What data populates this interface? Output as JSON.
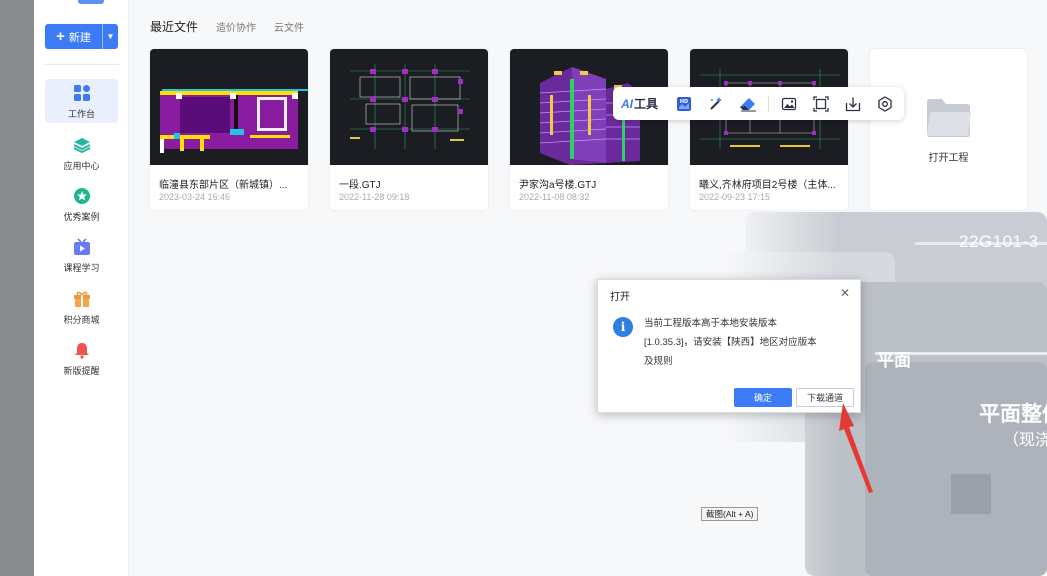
{
  "sidebar": {
    "new_button": {
      "label": "新建"
    },
    "items": [
      {
        "label": "工作台",
        "icon": "grid-icon",
        "active": true
      },
      {
        "label": "应用中心",
        "icon": "layers-icon"
      },
      {
        "label": "优秀案例",
        "icon": "star-badge-icon"
      },
      {
        "label": "课程学习",
        "icon": "tv-play-icon"
      },
      {
        "label": "积分商城",
        "icon": "gift-icon"
      },
      {
        "label": "新版提醒",
        "icon": "bell-icon"
      }
    ]
  },
  "tabs": [
    {
      "label": "最近文件",
      "active": true
    },
    {
      "label": "造价协作"
    },
    {
      "label": "云文件"
    }
  ],
  "files": [
    {
      "name": "临潼县东部片区（新城镇）...",
      "date": "2023-03-24 16:46"
    },
    {
      "name": "一段.GTJ",
      "date": "2022-11-28 09:18"
    },
    {
      "name": "尹家沟a号楼.GTJ",
      "date": "2022-11-08 08:32"
    },
    {
      "name": "曦义,齐林府项目2号楼（主体...",
      "date": "2022-09-23 17:15"
    }
  ],
  "open_project": {
    "label": "打开工程"
  },
  "ai_toolbar": {
    "ai_prefix": "AI",
    "label": "工具",
    "icons": [
      "hd-icon",
      "magic-wand-icon",
      "eraser-icon",
      "image-icon",
      "crop-icon",
      "download-icon",
      "settings-icon"
    ]
  },
  "dialog": {
    "title": "打开",
    "message_lines": [
      "当前工程版本高于本地安装版本",
      "[1.0.35.3]，请安装【陕西】地区对应版本",
      "及规则"
    ],
    "ok_label": "确定",
    "download_label": "下载通道"
  },
  "screenshot_tooltip": "截图(Alt + A)",
  "background_art": {
    "code": "22G101-3",
    "heading": "平面整体表",
    "sub": "（现浇混",
    "small": "平面"
  },
  "colors": {
    "accent": "#3b7bf6",
    "info": "#2f7fe0",
    "arrow": "#e53935"
  }
}
